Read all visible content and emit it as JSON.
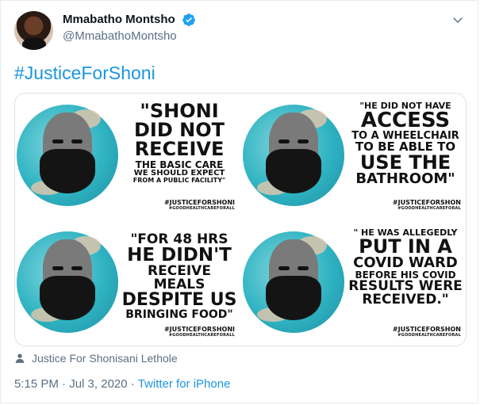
{
  "author": {
    "name": "Mmabatho Montsho",
    "handle": "@MmabathoMontsho"
  },
  "tweet": {
    "text": "#JusticeForShoni"
  },
  "media": {
    "panels": [
      {
        "lines": [
          "\"SHONI",
          "DID NOT",
          "RECEIVE",
          "THE BASIC CARE",
          "WE SHOULD EXPECT",
          "FROM A PUBLIC FACILITY\""
        ],
        "tag": "#JUSTICEFORSHONI",
        "sub": "#GOODHEALTHCAREFORALL"
      },
      {
        "lines": [
          "\"HE DID NOT HAVE",
          "ACCESS",
          "TO A WHEELCHAIR",
          "TO BE ABLE TO",
          "USE THE",
          "BATHROOM\""
        ],
        "tag": "#JUSTICEFORSHON",
        "sub": "#GOODHEALTHCAREFORAL"
      },
      {
        "lines": [
          "\"FOR 48 HRS",
          "HE DIDN'T",
          "RECEIVE MEALS",
          "DESPITE US",
          "BRINGING FOOD\""
        ],
        "tag": "#JUSTICEFORSHONI",
        "sub": "#GOODHEALTHCAREFORALL"
      },
      {
        "lines": [
          "\" HE WAS ALLEGEDLY",
          "PUT IN A",
          "COVID WARD",
          "BEFORE HIS COVID",
          "RESULTS WERE",
          "RECEIVED.\""
        ],
        "tag": "#JUSTICEFORSHON",
        "sub": "#GOODHEALTHCAREFORAL"
      }
    ]
  },
  "caption": "Justice For Shonisani Lethole",
  "meta": {
    "time": "5:15 PM",
    "sep1": "·",
    "date": "Jul 3, 2020",
    "sep2": "·",
    "source": "Twitter for iPhone"
  },
  "colors": {
    "link": "#1b95e0",
    "muted": "#5b7083",
    "verified": "#1da1f2"
  }
}
